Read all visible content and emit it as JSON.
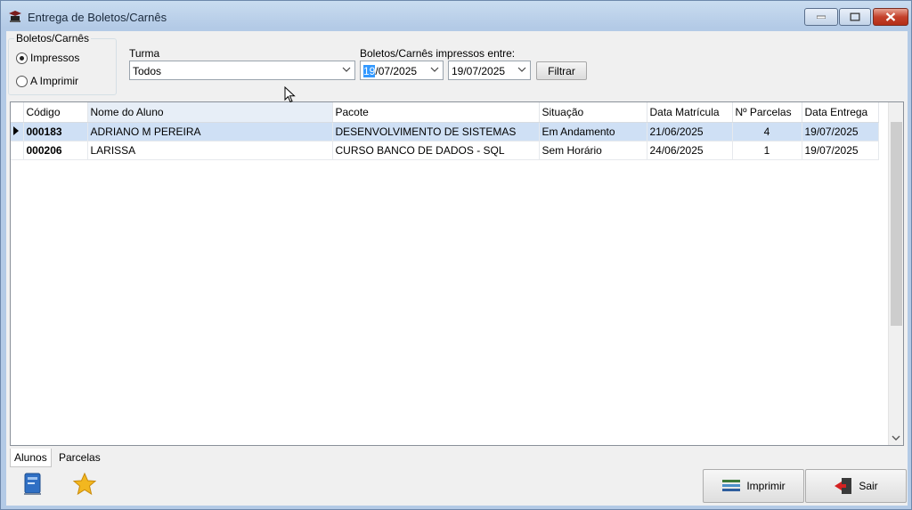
{
  "window": {
    "title": "Entrega de Boletos/Carnês"
  },
  "filter_group": {
    "label": "Boletos/Carnês",
    "options": [
      {
        "label": "Impressos",
        "selected": true
      },
      {
        "label": "A Imprimir",
        "selected": false
      }
    ]
  },
  "turma": {
    "label": "Turma",
    "value": "Todos"
  },
  "date_range": {
    "label": "Boletos/Carnês impressos entre:",
    "start_selected": "19",
    "start_rest": "/07/2025",
    "end": "19/07/2025"
  },
  "filtrar_button": {
    "label": "Filtrar"
  },
  "table": {
    "columns": [
      "Código",
      "Nome do Aluno",
      "Pacote",
      "Situação",
      "Data Matrícula",
      "Nº Parcelas",
      "Data Entrega"
    ],
    "rows": [
      {
        "codigo": "000183",
        "nome": "ADRIANO M PEREIRA",
        "pacote": "DESENVOLVIMENTO DE SISTEMAS",
        "situacao": "Em Andamento",
        "data_matricula": "21/06/2025",
        "parcelas": "4",
        "data_entrega": "19/07/2025",
        "selected": true
      },
      {
        "codigo": "000206",
        "nome": "LARISSA",
        "pacote": "CURSO BANCO DE DADOS - SQL",
        "situacao": "Sem Horário",
        "data_matricula": "24/06/2025",
        "parcelas": "1",
        "data_entrega": "19/07/2025",
        "selected": false
      }
    ]
  },
  "tabs": [
    {
      "label": "Alunos",
      "active": true
    },
    {
      "label": "Parcelas",
      "active": false
    }
  ],
  "toolbar_icons": [
    "book-icon",
    "star-icon"
  ],
  "buttons": {
    "imprimir": "Imprimir",
    "sair": "Sair"
  },
  "colors": {
    "title_bar": "#b3cae6",
    "selected_row": "#cfe0f5",
    "close_button": "#c4412c"
  }
}
